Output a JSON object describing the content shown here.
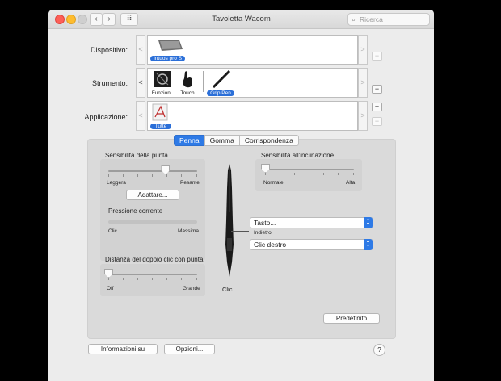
{
  "window": {
    "title": "Tavoletta Wacom",
    "search_placeholder": "Ricerca"
  },
  "nav": {
    "back": "‹",
    "forward": "›",
    "grid": "⠿"
  },
  "rows": {
    "device": {
      "label": "Dispositivo:",
      "items": [
        {
          "label": "Intuos pro S",
          "selected": true
        }
      ]
    },
    "tool": {
      "label": "Strumento:",
      "items": [
        {
          "label": "Funzioni",
          "selected": false
        },
        {
          "label": "Touch",
          "selected": false
        },
        {
          "label": "Grip Pen",
          "selected": true
        }
      ]
    },
    "application": {
      "label": "Applicazione:",
      "items": [
        {
          "label": "Tutte",
          "selected": true
        }
      ]
    }
  },
  "buttons": {
    "plus": "+",
    "minus": "−",
    "left_arrow": "<",
    "right_arrow": ">"
  },
  "tabs": [
    "Penna",
    "Gomma",
    "Corrispondenza"
  ],
  "tip": {
    "title": "Sensibilità della punta",
    "min": "Leggera",
    "max": "Pesante",
    "value_fraction": 0.64,
    "adjust_button": "Adattare...",
    "pressure_title": "Pressione corrente",
    "pressure_min": "Clic",
    "pressure_max": "Massima"
  },
  "tilt": {
    "title": "Sensibilità all'inclinazione",
    "min": "Normale",
    "max": "Alta",
    "value_fraction": 0.0
  },
  "double_click": {
    "title": "Distanza del doppio clic con punta",
    "min": "Off",
    "max": "Grande",
    "value_fraction": 0.0
  },
  "pen": {
    "upper_button": "Tasto...",
    "between_label": "Indietro",
    "lower_button": "Clic destro",
    "tip_label": "Clic"
  },
  "default_button": "Predefinito",
  "footer": {
    "about": "Informazioni su",
    "options": "Opzioni...",
    "help": "?"
  }
}
